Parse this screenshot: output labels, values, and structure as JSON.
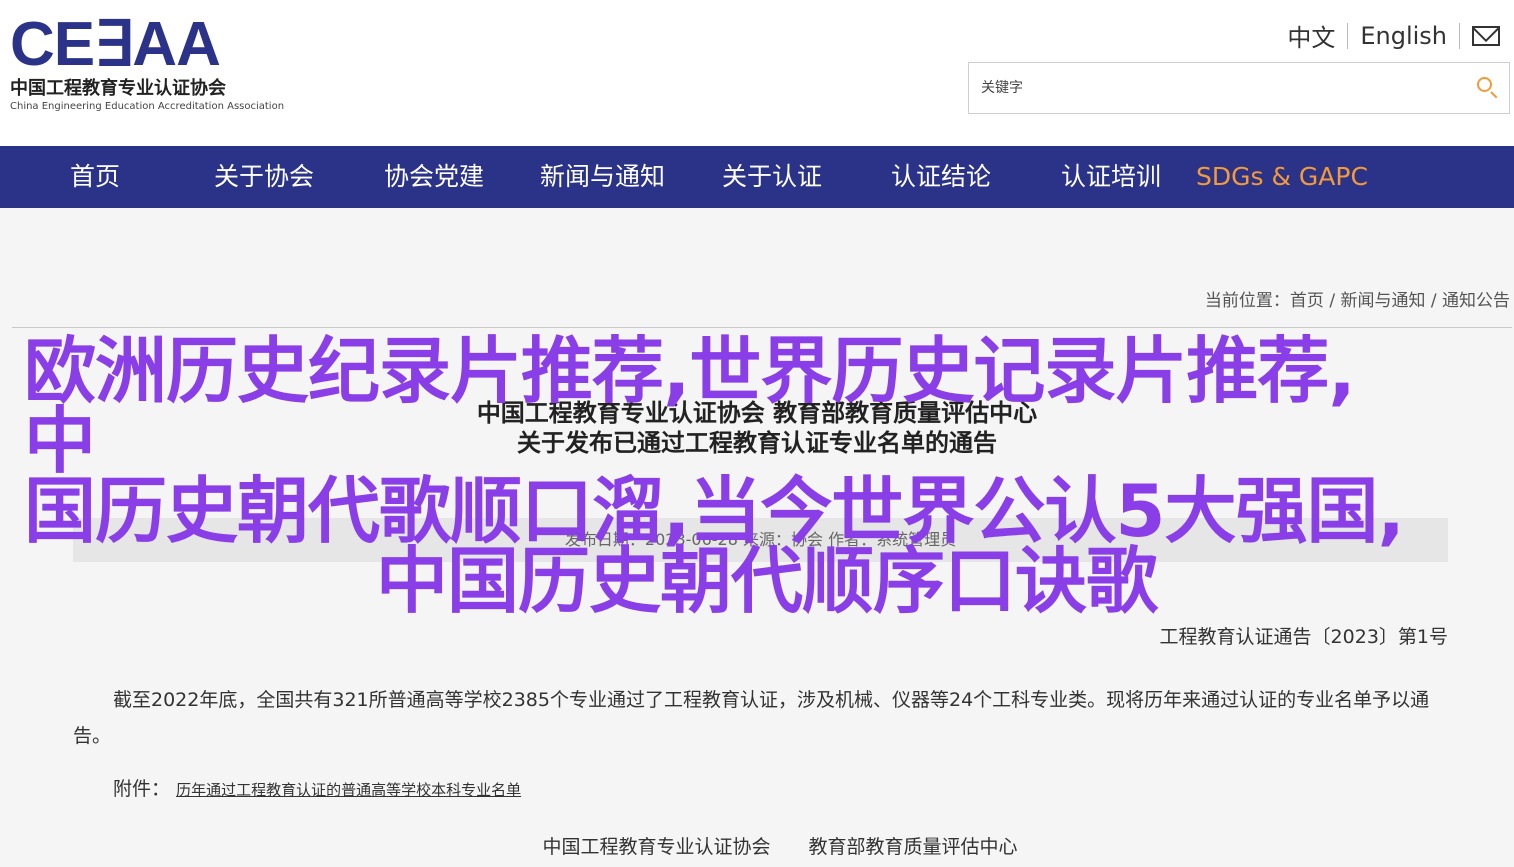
{
  "header": {
    "logo": {
      "word": "CE∃AA",
      "cn": "中国工程教育专业认证协会",
      "en": "China Engineering Education Accreditation Association"
    },
    "lang": {
      "zh": "中文",
      "en": "English"
    },
    "search": {
      "placeholder": "关键字"
    }
  },
  "nav": {
    "items": [
      {
        "label": "首页"
      },
      {
        "label": "关于协会"
      },
      {
        "label": "协会党建"
      },
      {
        "label": "新闻与通知"
      },
      {
        "label": "关于认证"
      },
      {
        "label": "认证结论"
      },
      {
        "label": "认证培训"
      },
      {
        "label": "SDGs & GAPC"
      }
    ],
    "highlight_color": "#f39a3a"
  },
  "breadcrumb": "当前位置：首页 / 新闻与通知 / 通知公告",
  "article": {
    "title_line1": "中国工程教育专业认证协会 教育部教育质量评估中心",
    "title_line2": "关于发布已通过工程教育认证专业名单的通告",
    "meta": "发布日期：2023-06-28   来源：协会   作者：系统管理员",
    "notice_no": "工程教育认证通告〔2023〕第1号",
    "body": "截至2022年底，全国共有321所普通高等学校2385个专业通过了工程教育认证，涉及机械、仪器等24个工科专业类。现将历年来通过认证的专业名单予以通告。",
    "attachment_label": "附件：",
    "attachment_link": "历年通过工程教育认证的普通高等学校本科专业名单",
    "signature": "中国工程教育专业认证协会　　教育部教育质量评估中心"
  },
  "overlay": {
    "line1": "欧洲历史纪录片推荐,世界历史记录片推荐,中",
    "line2": "国历史朝代歌顺口溜,当今世界公认5大强国,",
    "line3": "中国历史朝代顺序口诀歌",
    "color": "#8a3ee8"
  }
}
